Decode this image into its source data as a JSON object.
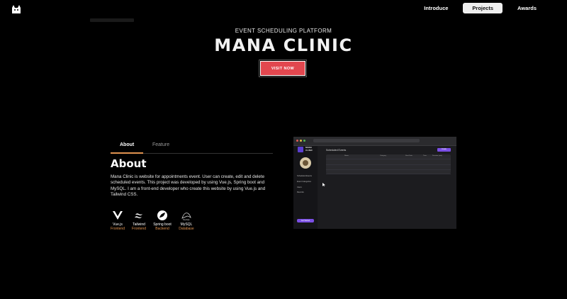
{
  "nav": {
    "items": [
      {
        "label": "Introduce",
        "active": false
      },
      {
        "label": "Projects",
        "active": true
      },
      {
        "label": "Awards",
        "active": false
      }
    ]
  },
  "hero": {
    "subtitle": "EVENT SCHEDULING PLATFORM",
    "title": "MANA CLINIC",
    "button": "VISIT NOW",
    "button_color": "#e2474f"
  },
  "tabs": [
    "About",
    "Feature"
  ],
  "about": {
    "heading": "About",
    "text": "Mana Clinic is website for appointments event. User can create, edit and delete scheduled events. This project was developed by using Vue.js, Spring boot and MySQL. I am a front-end developer who create this website by using Vue.js and Tailwind CSS."
  },
  "stack": [
    {
      "name": "Vue.js",
      "role": "Frontend",
      "icon": "vue-icon"
    },
    {
      "name": "Tailwind",
      "role": "Frontend",
      "icon": "tailwind-icon"
    },
    {
      "name": "Spring boot",
      "role": "Backend",
      "icon": "spring-icon"
    },
    {
      "name": "MySQL",
      "role": "Database",
      "icon": "mysql-icon"
    }
  ],
  "accent_color": "#e0924f",
  "preview": {
    "brand": "MANA\nCLINIC",
    "page_title": "Scheduled Events",
    "create_button": "Create",
    "menu": [
      "Scheduled Events",
      "Event Categories",
      "Users",
      "Records"
    ],
    "cta": "Get Started",
    "columns": [
      "Name",
      "Category",
      "Start Date",
      "Time",
      "Duration (min)"
    ]
  }
}
